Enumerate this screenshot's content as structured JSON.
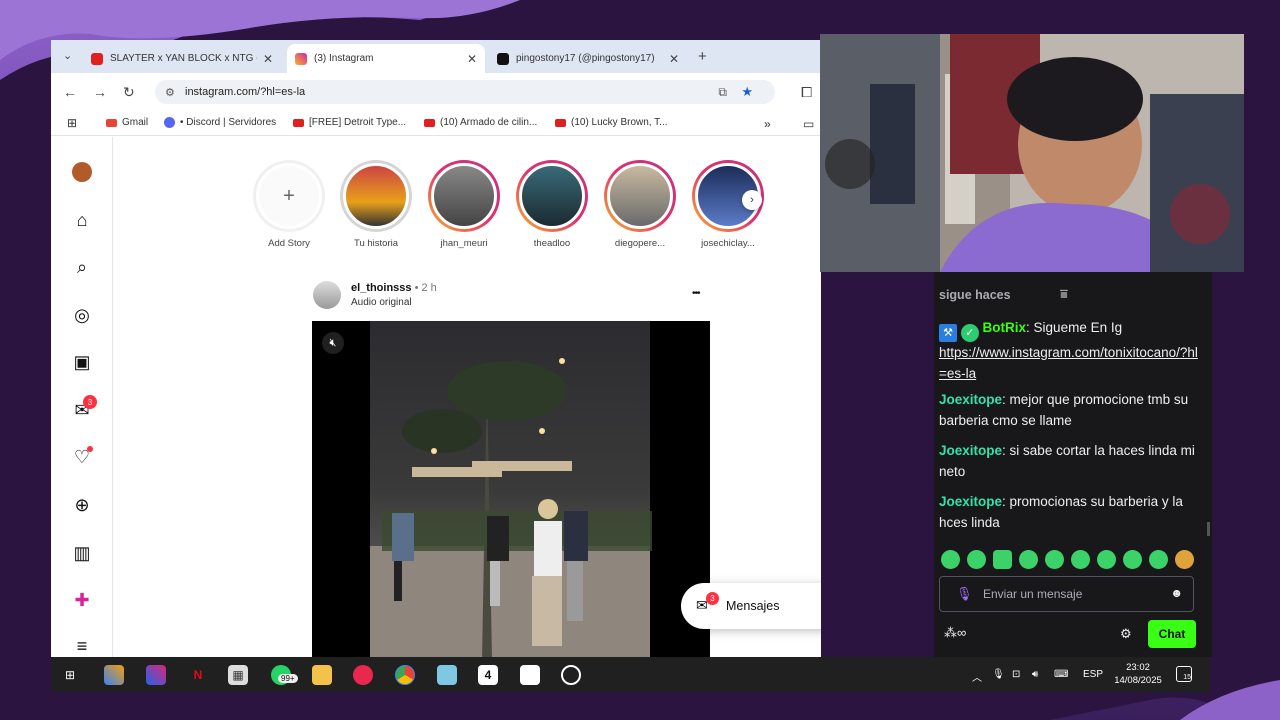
{
  "browser": {
    "tabs": [
      {
        "title": "SLAYTER x YAN BLOCK x NTG -",
        "icon": "youtube-icon",
        "color": "#e02020"
      },
      {
        "title": "(3) Instagram",
        "icon": "instagram-icon",
        "color": "#d6249f"
      },
      {
        "title": "pingostony17 (@pingostony17)",
        "icon": "tiktok-icon",
        "color": "#111111"
      }
    ],
    "url": "instagram.com/?hl=es-la",
    "bookmarks": [
      "Gmail",
      "• Discord | Servidores",
      "[FREE] Detroit Type...",
      "(10) Armado de cilin...",
      "(10) Lucky Brown, T..."
    ]
  },
  "instagram": {
    "stories": [
      {
        "name": "Add Story"
      },
      {
        "name": "Tu historia"
      },
      {
        "name": "jhan_meuri"
      },
      {
        "name": "theadloo"
      },
      {
        "name": "diegopere..."
      },
      {
        "name": "josechiclay..."
      }
    ],
    "post": {
      "user": "el_thoinsss",
      "time": "• 2 h",
      "audio": "Audio original",
      "more": "•••"
    },
    "notification_badge": "3",
    "messages": {
      "label": "Mensajes",
      "badge": "3"
    }
  },
  "chat": {
    "truncated": "sigue haces",
    "messages": [
      {
        "user": "BotRix",
        "bot": true,
        "text": "Sigueme En Ig",
        "link": "https://www.instagram.com/tonixitocano/?hl=es-la"
      },
      {
        "user": "Joexitope",
        "text": "mejor que promocione tmb su barberia cmo se llame"
      },
      {
        "user": "Joexitope",
        "text": "si sabe cortar la haces linda mi neto"
      },
      {
        "user": "Joexitope",
        "text": "promocionas su barberia y la hces linda"
      }
    ],
    "input_placeholder": "Enviar un mensaje",
    "button": "Chat"
  },
  "taskbar": {
    "whatsapp_badge": "99+",
    "lang": "ESP",
    "time": "23:02",
    "date": "14/08/2025",
    "notif_count": "15"
  },
  "colors": {
    "accent_green": "#39ff14",
    "user_color": "#33e3a8",
    "chat_bg": "#18181b"
  }
}
